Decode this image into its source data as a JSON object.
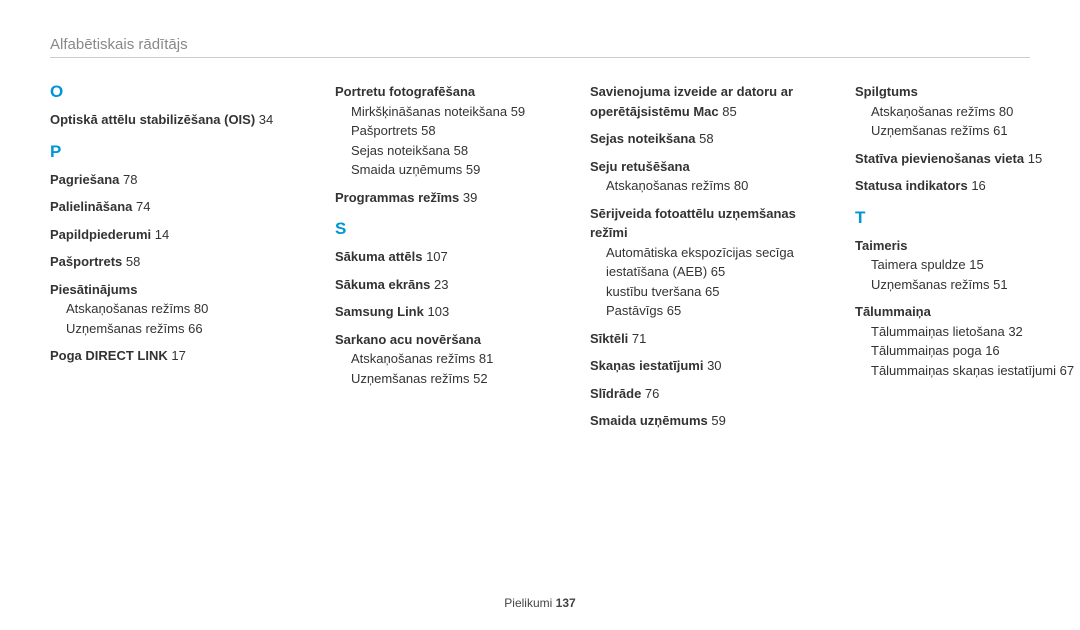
{
  "header_title": "Alfabētiskais rādītājs",
  "footer_label": "Pielikumi",
  "footer_page": "137",
  "letters": {
    "O": "O",
    "P": "P",
    "S": "S",
    "T": "T"
  },
  "col1": {
    "e1": {
      "t": "Optiskā attēlu stabilizēšana (OIS)",
      "p": "34"
    },
    "e2": {
      "t": "Pagriešana",
      "p": "78"
    },
    "e3": {
      "t": "Palielināšana",
      "p": "74"
    },
    "e4": {
      "t": "Papildpiederumi",
      "p": "14"
    },
    "e5": {
      "t": "Pašportrets",
      "p": "58"
    },
    "e6": {
      "t": "Piesātinājums"
    },
    "s6a": {
      "t": "Atskaņošanas režīms",
      "p": "80"
    },
    "s6b": {
      "t": "Uzņemšanas režīms",
      "p": "66"
    },
    "e7": {
      "t": "Poga DIRECT LINK",
      "p": "17"
    }
  },
  "col2": {
    "e1": {
      "t": "Portretu fotografēšana"
    },
    "s1a": {
      "t": "Mirkšķināšanas noteikšana",
      "p": "59"
    },
    "s1b": {
      "t": "Pašportrets",
      "p": "58"
    },
    "s1c": {
      "t": "Sejas noteikšana",
      "p": "58"
    },
    "s1d": {
      "t": "Smaida uzņēmums",
      "p": "59"
    },
    "e2": {
      "t": "Programmas režīms",
      "p": "39"
    },
    "e3": {
      "t": "Sākuma attēls",
      "p": "107"
    },
    "e4": {
      "t": "Sākuma ekrāns",
      "p": "23"
    },
    "e5": {
      "t": "Samsung Link",
      "p": "103"
    },
    "e6": {
      "t": "Sarkano acu novēršana"
    },
    "s6a": {
      "t": "Atskaņošanas režīms",
      "p": "81"
    },
    "s6b": {
      "t": "Uzņemšanas režīms",
      "p": "52"
    }
  },
  "col3": {
    "e1": {
      "t": "Savienojuma izveide ar datoru ar operētājsistēmu Mac",
      "p": "85"
    },
    "e2": {
      "t": "Sejas noteikšana",
      "p": "58"
    },
    "e3": {
      "t": "Seju retušēšana"
    },
    "s3a": {
      "t": "Atskaņošanas režīms",
      "p": "80"
    },
    "e4": {
      "t": "Sērijveida fotoattēlu uzņemšanas režīmi"
    },
    "s4a": {
      "t": "Automātiska ekspozīcijas secīga iestatīšana (AEB)",
      "p": "65"
    },
    "s4b": {
      "t": "kustību tveršana",
      "p": "65"
    },
    "s4c": {
      "t": "Pastāvīgs",
      "p": "65"
    },
    "e5": {
      "t": "Sīktēli",
      "p": "71"
    },
    "e6": {
      "t": "Skaņas iestatījumi",
      "p": "30"
    },
    "e7": {
      "t": "Slīdrāde",
      "p": "76"
    },
    "e8": {
      "t": "Smaida uzņēmums",
      "p": "59"
    }
  },
  "col4": {
    "e1": {
      "t": "Spilgtums"
    },
    "s1a": {
      "t": "Atskaņošanas režīms",
      "p": "80"
    },
    "s1b": {
      "t": "Uzņemšanas režīms",
      "p": "61"
    },
    "e2": {
      "t": "Statīva pievienošanas vieta",
      "p": "15"
    },
    "e3": {
      "t": "Statusa indikators",
      "p": "16"
    },
    "e4": {
      "t": "Taimeris"
    },
    "s4a": {
      "t": "Taimera spuldze",
      "p": "15"
    },
    "s4b": {
      "t": "Uzņemšanas režīms",
      "p": "51"
    },
    "e5": {
      "t": "Tālummaiņa"
    },
    "s5a": {
      "t": "Tālummaiņas lietošana",
      "p": "32"
    },
    "s5b": {
      "t": "Tālummaiņas poga",
      "p": "16"
    },
    "s5c": {
      "t": "Tālummaiņas skaņas iestatījumi",
      "p": "67"
    }
  }
}
